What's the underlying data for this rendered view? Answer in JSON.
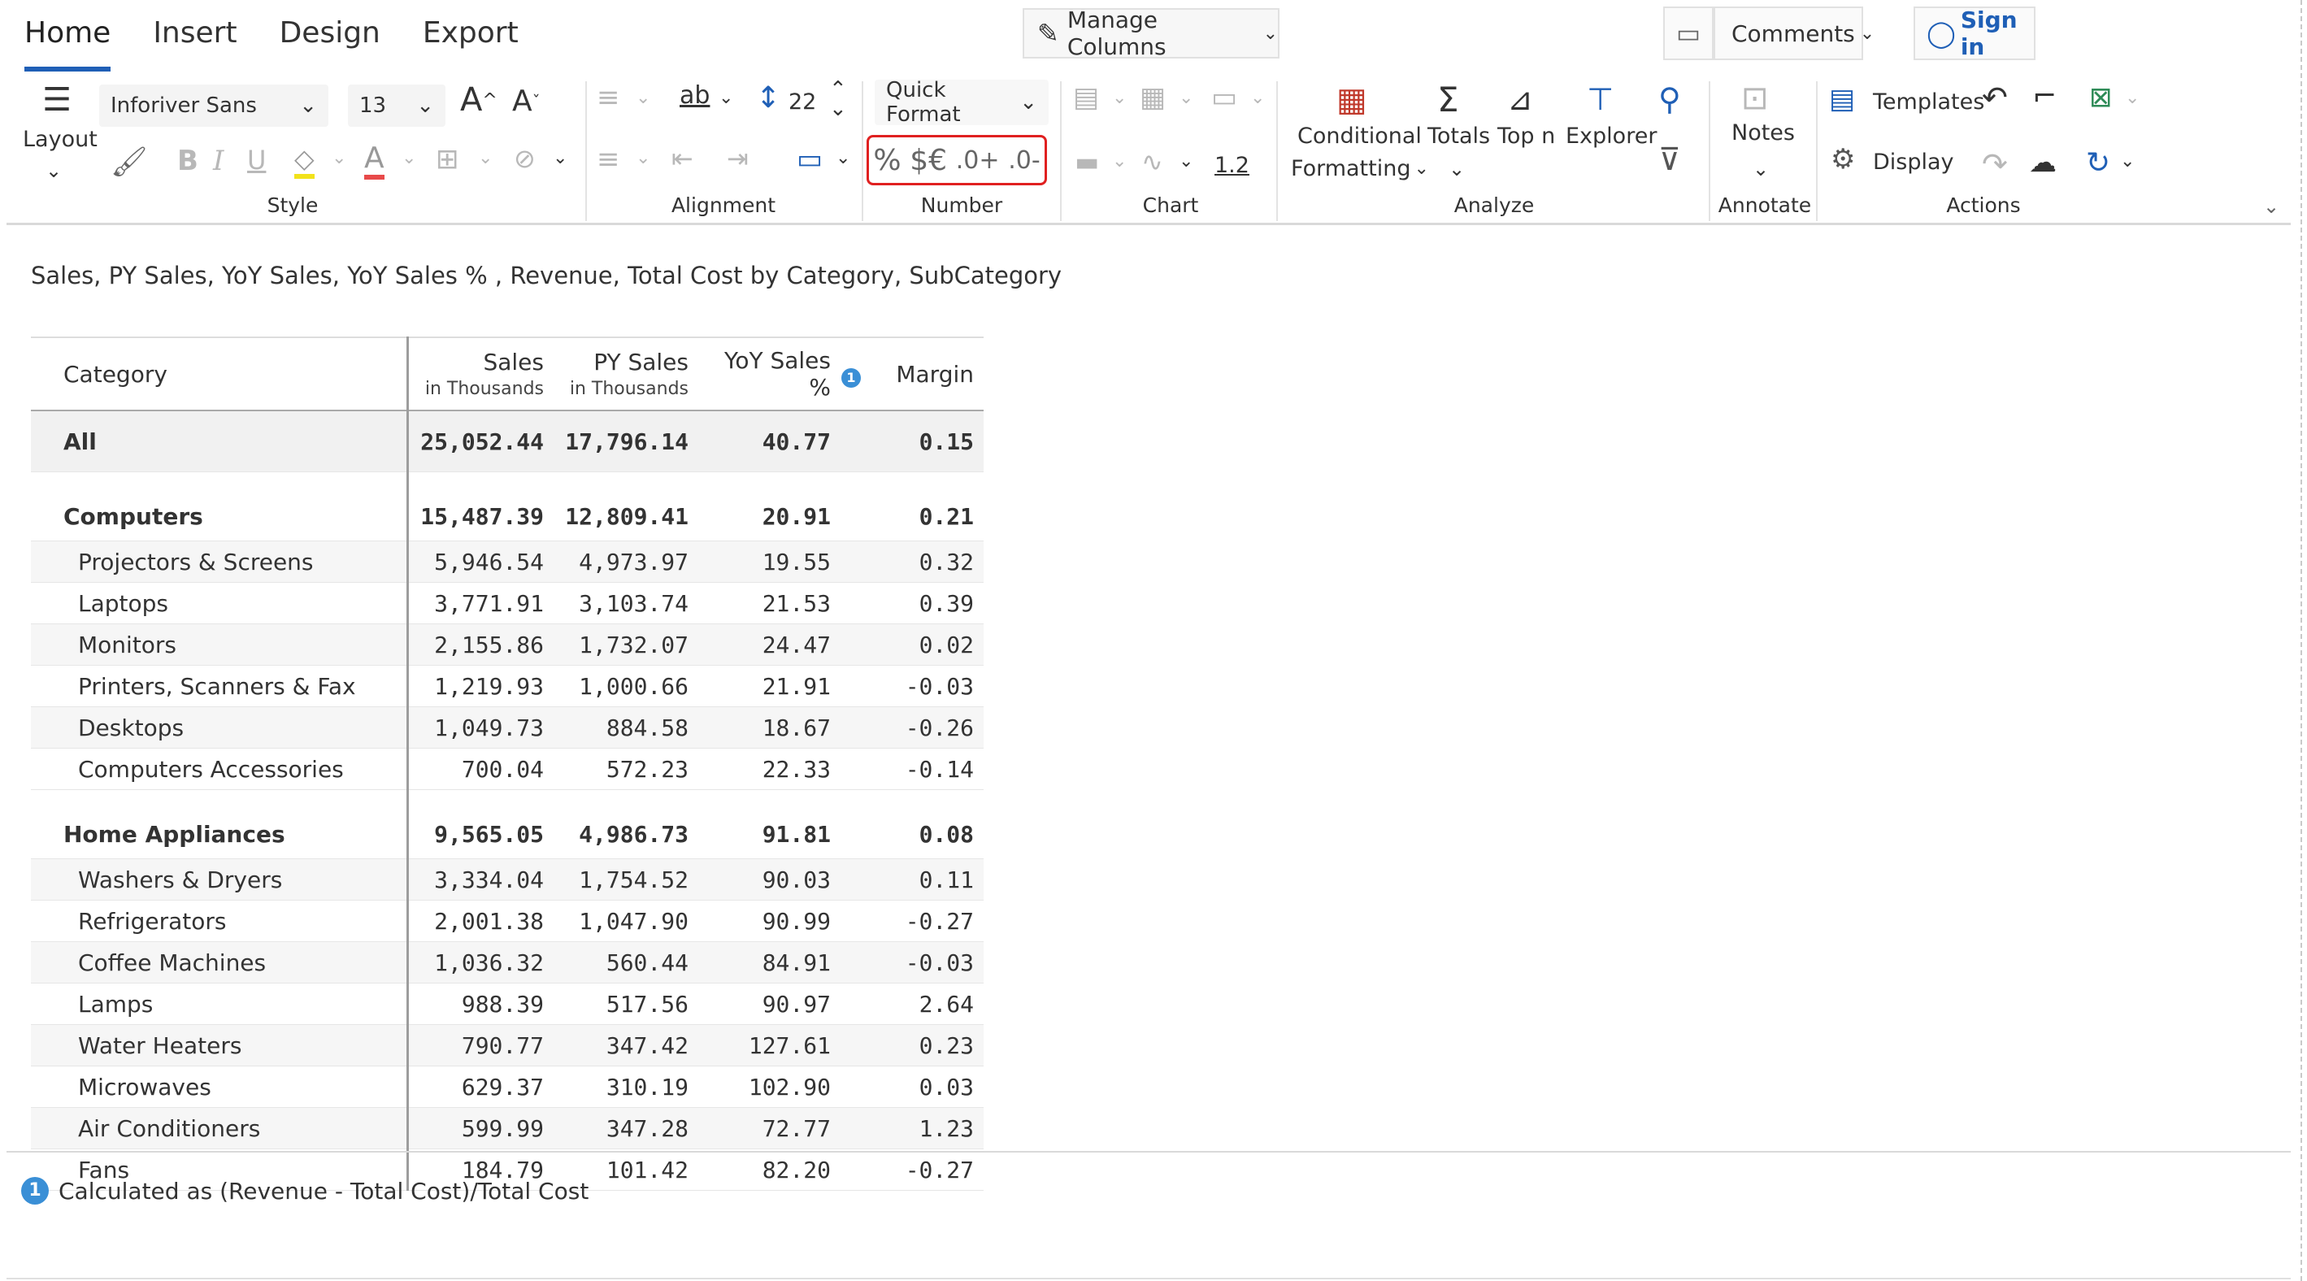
{
  "tabs": [
    "Home",
    "Insert",
    "Design",
    "Export"
  ],
  "header": {
    "manage_columns": "Manage Columns",
    "comments": "Comments",
    "sign_in": "Sign in"
  },
  "ribbon": {
    "layout": "Layout",
    "font_name": "Inforiver Sans",
    "font_size": "13",
    "row_height": "22",
    "quick_format": "Quick Format",
    "number_symbols": [
      "%",
      "$€",
      ".0+",
      ".0-"
    ],
    "chart_value": "1.2",
    "conditional_formatting": [
      "Conditional",
      "Formatting"
    ],
    "totals": "Totals",
    "top_n": "Top n",
    "explorer": "Explorer",
    "notes": "Notes",
    "templates": "Templates",
    "display": "Display",
    "groups": {
      "style": "Style",
      "alignment": "Alignment",
      "number": "Number",
      "chart": "Chart",
      "analyze": "Analyze",
      "annotate": "Annotate",
      "actions": "Actions"
    }
  },
  "report": {
    "subtitle": "Sales, PY Sales, YoY Sales, YoY Sales % , Revenue, Total Cost by Category, SubCategory",
    "columns": {
      "category": "Category",
      "sales": "Sales",
      "sales_sub": "in Thousands",
      "py_sales": "PY Sales",
      "py_sales_sub": "in Thousands",
      "yoy_pct": "YoY Sales %",
      "note_badge": "1",
      "margin": "Margin"
    },
    "total": {
      "label": "All",
      "sales": "25,052.44",
      "py": "17,796.14",
      "yoy": "40.77",
      "margin": "0.15"
    },
    "groups": [
      {
        "label": "Computers",
        "sales": "15,487.39",
        "py": "12,809.41",
        "yoy": "20.91",
        "margin": "0.21",
        "rows": [
          {
            "label": "Projectors & Screens",
            "sales": "5,946.54",
            "py": "4,973.97",
            "yoy": "19.55",
            "margin": "0.32"
          },
          {
            "label": "Laptops",
            "sales": "3,771.91",
            "py": "3,103.74",
            "yoy": "21.53",
            "margin": "0.39"
          },
          {
            "label": "Monitors",
            "sales": "2,155.86",
            "py": "1,732.07",
            "yoy": "24.47",
            "margin": "0.02"
          },
          {
            "label": "Printers, Scanners & Fax",
            "sales": "1,219.93",
            "py": "1,000.66",
            "yoy": "21.91",
            "margin": "-0.03"
          },
          {
            "label": "Desktops",
            "sales": "1,049.73",
            "py": "884.58",
            "yoy": "18.67",
            "margin": "-0.26"
          },
          {
            "label": "Computers Accessories",
            "sales": "700.04",
            "py": "572.23",
            "yoy": "22.33",
            "margin": "-0.14"
          }
        ]
      },
      {
        "label": "Home Appliances",
        "sales": "9,565.05",
        "py": "4,986.73",
        "yoy": "91.81",
        "margin": "0.08",
        "rows": [
          {
            "label": "Washers & Dryers",
            "sales": "3,334.04",
            "py": "1,754.52",
            "yoy": "90.03",
            "margin": "0.11"
          },
          {
            "label": "Refrigerators",
            "sales": "2,001.38",
            "py": "1,047.90",
            "yoy": "90.99",
            "margin": "-0.27"
          },
          {
            "label": "Coffee Machines",
            "sales": "1,036.32",
            "py": "560.44",
            "yoy": "84.91",
            "margin": "-0.03"
          },
          {
            "label": "Lamps",
            "sales": "988.39",
            "py": "517.56",
            "yoy": "90.97",
            "margin": "2.64"
          },
          {
            "label": "Water Heaters",
            "sales": "790.77",
            "py": "347.42",
            "yoy": "127.61",
            "margin": "0.23"
          },
          {
            "label": "Microwaves",
            "sales": "629.37",
            "py": "310.19",
            "yoy": "102.90",
            "margin": "0.03"
          },
          {
            "label": "Air Conditioners",
            "sales": "599.99",
            "py": "347.28",
            "yoy": "72.77",
            "margin": "1.23"
          },
          {
            "label": "Fans",
            "sales": "184.79",
            "py": "101.42",
            "yoy": "82.20",
            "margin": "-0.27"
          }
        ]
      }
    ],
    "footnote_badge": "1",
    "footnote": "Calculated as (Revenue - Total Cost)/Total Cost"
  }
}
